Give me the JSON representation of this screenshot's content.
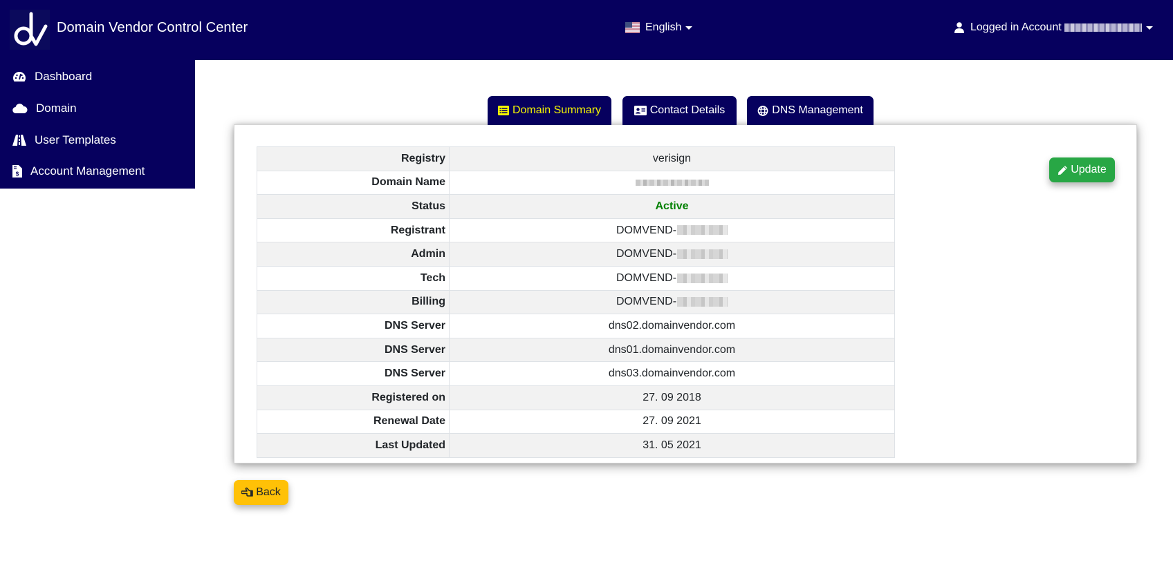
{
  "header": {
    "app_title": "Domain Vendor Control Center",
    "logo_icon": "dv-logo",
    "language": {
      "label": "English",
      "icon": "us-flag-icon"
    },
    "account": {
      "label": "Logged in Account",
      "icon": "user-icon",
      "account_id_redacted": true
    }
  },
  "sidebar": {
    "items": [
      {
        "label": "Dashboard",
        "icon": "tachometer-icon"
      },
      {
        "label": "Domain",
        "icon": "cloud-icon"
      },
      {
        "label": "User Templates",
        "icon": "road-icon"
      },
      {
        "label": "Account Management",
        "icon": "invoice-dollar-icon"
      }
    ]
  },
  "tabs": [
    {
      "label": "Domain Summary",
      "icon": "list-icon",
      "active": true
    },
    {
      "label": "Contact Details",
      "icon": "address-card-icon",
      "active": false
    },
    {
      "label": "DNS Management",
      "icon": "globe-icon",
      "active": false
    }
  ],
  "summary": {
    "rows": [
      {
        "label": "Registry",
        "value": "verisign"
      },
      {
        "label": "Domain Name",
        "value": "",
        "redacted": true
      },
      {
        "label": "Status",
        "value": "Active"
      },
      {
        "label": "Registrant",
        "value": "DOMVEND-",
        "redacted_suffix": true
      },
      {
        "label": "Admin",
        "value": "DOMVEND-",
        "redacted_suffix": true
      },
      {
        "label": "Tech",
        "value": "DOMVEND-",
        "redacted_suffix": true
      },
      {
        "label": "Billing",
        "value": "DOMVEND-",
        "redacted_suffix": true
      },
      {
        "label": "DNS Server",
        "value": "dns02.domainvendor.com"
      },
      {
        "label": "DNS Server",
        "value": "dns01.domainvendor.com"
      },
      {
        "label": "DNS Server",
        "value": "dns03.domainvendor.com"
      },
      {
        "label": "Registered on",
        "value": "27. 09 2018"
      },
      {
        "label": "Renewal Date",
        "value": "27. 09 2021"
      },
      {
        "label": "Last Updated",
        "value": "31. 05 2021"
      }
    ]
  },
  "buttons": {
    "update_label": "Update",
    "update_icon": "pencil-icon",
    "back_label": "Back",
    "back_icon": "hand-point-left-icon"
  },
  "colors": {
    "brand_navy": "#06005e",
    "active_tab_text": "#f5f500",
    "status_active": "#008000",
    "update_green": "#28a745",
    "back_yellow": "#ffc107"
  }
}
